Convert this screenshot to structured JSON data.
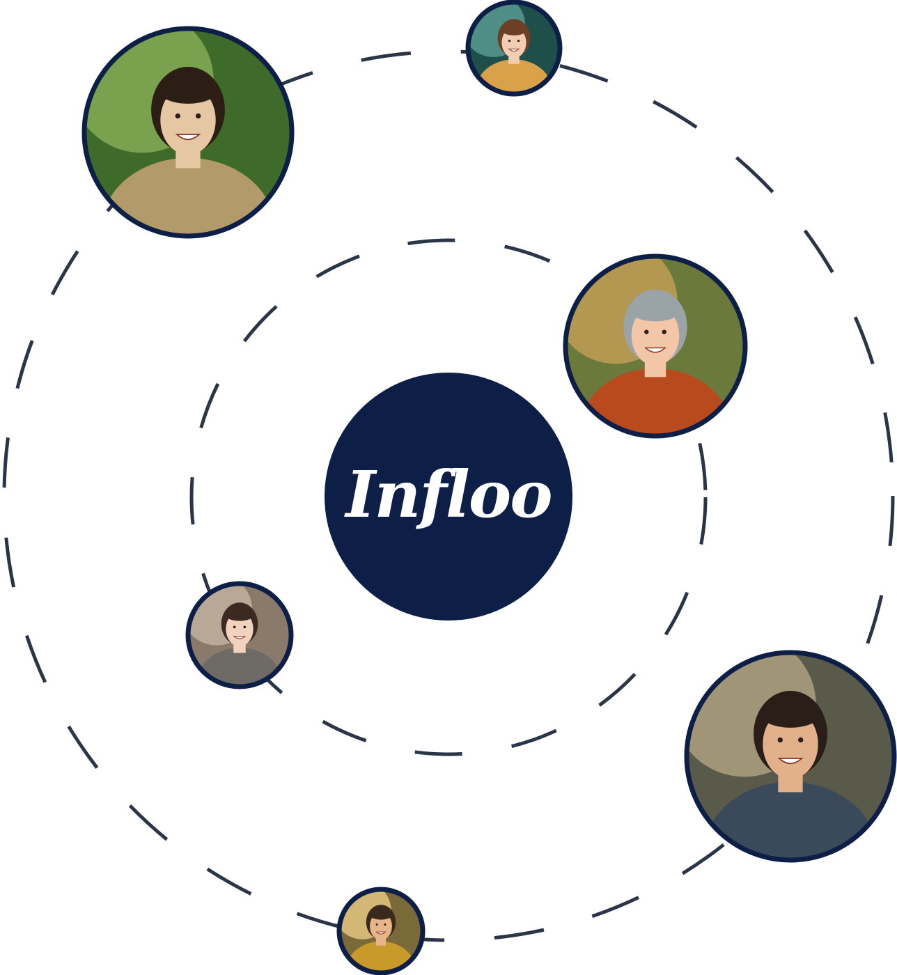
{
  "brand": {
    "logo_text": "Infloo"
  },
  "colors": {
    "center_fill": "#0d1f46",
    "orbit_stroke": "#2b3548",
    "avatar_border": "#0d1f46",
    "background": "#ffffff"
  },
  "avatars": [
    {
      "id": "avatar-man-olive-jacket",
      "palette": [
        "#3f6b2a",
        "#8fb35a",
        "#b39a6a",
        "#e6c7a4",
        "#2c1e14"
      ]
    },
    {
      "id": "avatar-woman-braid",
      "palette": [
        "#1f4f4a",
        "#5fa39a",
        "#d9a24a",
        "#f2cdb1",
        "#6b4026"
      ]
    },
    {
      "id": "avatar-woman-red-hair",
      "palette": [
        "#6b7a3a",
        "#c9a35a",
        "#b84a1e",
        "#f3c6a8",
        "#9aa3a6"
      ]
    },
    {
      "id": "avatar-woman-scarf",
      "palette": [
        "#8a7a6a",
        "#c7b8a6",
        "#6e6a66",
        "#f1d2bd",
        "#3b2a22"
      ]
    },
    {
      "id": "avatar-man-curly-hair",
      "palette": [
        "#5a5a4a",
        "#b9a988",
        "#3b4a5a",
        "#e2b08a",
        "#2a1e18"
      ]
    },
    {
      "id": "avatar-man-yellow-jacket",
      "palette": [
        "#7a6a3a",
        "#f0d28a",
        "#c79a2a",
        "#e8b48a",
        "#3a2a1e"
      ]
    }
  ]
}
